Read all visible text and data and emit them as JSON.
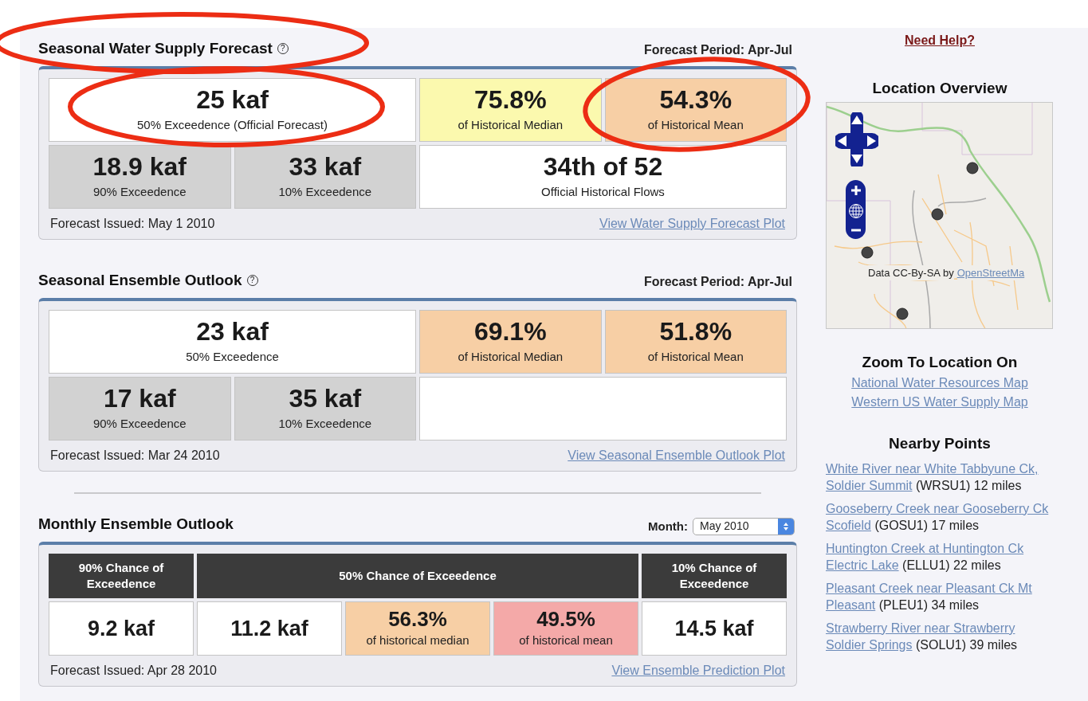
{
  "sections": [
    {
      "kind": "grid",
      "title": "Seasonal Water Supply Forecast",
      "help": "?",
      "period": "Forecast Period: Apr-Jul",
      "cells": [
        {
          "kind": "wide",
          "value": "25 kaf",
          "caption": "50% Exceedence (Official Forecast)",
          "color": "#ffffff"
        },
        {
          "kind": "narrow",
          "value": "75.8%",
          "caption": "of Historical Median",
          "color": "#fbf9ae"
        },
        {
          "kind": "narrow",
          "value": "54.3%",
          "caption": "of Historical Mean",
          "color": "#f7cfa5"
        },
        {
          "kind": "narrow",
          "value": "18.9 kaf",
          "caption": "90% Exceedence",
          "color": "#d2d2d2"
        },
        {
          "kind": "narrow",
          "value": "33 kaf",
          "caption": "10% Exceedence",
          "color": "#d2d2d2"
        },
        {
          "kind": "wide",
          "value": "34th of 52",
          "caption": "Official Historical Flows",
          "color": "#ffffff"
        }
      ],
      "issued": "Forecast Issued: May 1 2010",
      "link": "View Water Supply Forecast Plot"
    },
    {
      "kind": "grid",
      "title": "Seasonal Ensemble Outlook",
      "help": "?",
      "period": "Forecast Period: Apr-Jul",
      "cells": [
        {
          "kind": "wide",
          "value": "23 kaf",
          "caption": "50% Exceedence",
          "color": "#ffffff"
        },
        {
          "kind": "narrow",
          "value": "69.1%",
          "caption": "of Historical Median",
          "color": "#f7cfa5"
        },
        {
          "kind": "narrow",
          "value": "51.8%",
          "caption": "of Historical Mean",
          "color": "#f7cfa5"
        },
        {
          "kind": "narrow",
          "value": "17 kaf",
          "caption": "90% Exceedence",
          "color": "#d2d2d2"
        },
        {
          "kind": "narrow",
          "value": "35 kaf",
          "caption": "10% Exceedence",
          "color": "#d2d2d2"
        },
        {
          "kind": "wide",
          "color": "#ffffff"
        }
      ],
      "issued": "Forecast Issued: Mar 24 2010",
      "link": "View Seasonal Ensemble Outlook Plot"
    },
    {
      "kind": "table",
      "title": "Monthly Ensemble Outlook",
      "month_label": "Month:",
      "month_value": "May 2010",
      "header": [
        {
          "kind": "narrow",
          "label": "90% Chance of Exceedence"
        },
        {
          "kind": "wide",
          "label": "50% Chance of Exceedence"
        },
        {
          "kind": "narrow",
          "label": "10% Chance of Exceedence"
        }
      ],
      "cells": [
        {
          "value": "9.2 kaf",
          "color": "#ffffff"
        },
        {
          "value": "11.2 kaf",
          "color": "#ffffff"
        },
        {
          "value": "56.3%",
          "caption": "of historical median",
          "color": "#f7cfa5"
        },
        {
          "value": "49.5%",
          "caption": "of historical mean",
          "color": "#f4a9a8"
        },
        {
          "value": "14.5 kaf",
          "color": "#ffffff"
        }
      ],
      "issued": "Forecast Issued: Apr 28 2010",
      "link": "View Ensemble Prediction Plot"
    }
  ],
  "sidebar": {
    "help_link": "Need Help?",
    "overview_title": "Location Overview",
    "map": {
      "kind": "picture",
      "attribution": "Data CC-By-SA by",
      "attribution_link": "OpenStreetMa"
    },
    "zoom_title": "Zoom To Location On",
    "zoom_links": [
      "National Water Resources Map",
      "Western US Water Supply Map"
    ],
    "nearby_title": "Nearby Points",
    "nearby": [
      {
        "link": "White River near White Tabbyune Ck, Soldier Summit",
        "detail": "(WRSU1) 12 miles"
      },
      {
        "link": "Gooseberry Creek near Gooseberry Ck Scofield",
        "detail": "(GOSU1) 17 miles"
      },
      {
        "link": "Huntington Creek at Huntington Ck Electric Lake",
        "detail": "(ELLU1) 22 miles"
      },
      {
        "link": "Pleasant Creek near Pleasant Ck Mt Pleasant",
        "detail": "(PLEU1) 34 miles"
      },
      {
        "link": "Strawberry River near Strawberry Soldier Springs",
        "detail": "(SOLU1) 39 miles"
      }
    ]
  },
  "highlight_marks": [
    {
      "kind": "ellipse"
    },
    {
      "kind": "ellipse"
    },
    {
      "kind": "ellipse"
    }
  ]
}
